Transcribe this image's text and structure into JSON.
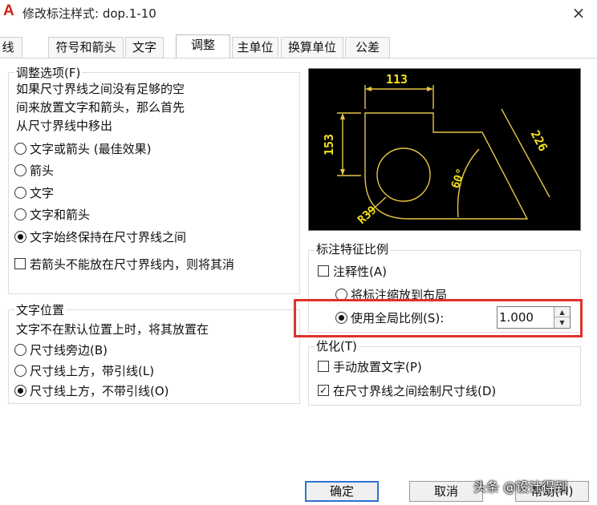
{
  "window": {
    "title": "修改标注样式: dop.1-10",
    "app_icon": "A",
    "close_symbol": "×"
  },
  "tabs": [
    {
      "label": "线"
    },
    {
      "label": "符号和箭头"
    },
    {
      "label": "文字"
    },
    {
      "label": "调整"
    },
    {
      "label": "主单位"
    },
    {
      "label": "换算单位"
    },
    {
      "label": "公差"
    }
  ],
  "fit_options": {
    "title": "调整选项(F)",
    "description": [
      "如果尺寸界线之间没有足够的空",
      "间来放置文字和箭头，那么首先",
      "从尺寸界线中移出"
    ],
    "radios": [
      {
        "label": "文字或箭头 (最佳效果)",
        "selected": false
      },
      {
        "label": "箭头",
        "selected": false
      },
      {
        "label": "文字",
        "selected": false
      },
      {
        "label": "文字和箭头",
        "selected": false
      },
      {
        "label": "文字始终保持在尺寸界线之间",
        "selected": true
      }
    ],
    "checkbox": {
      "label": "若箭头不能放在尺寸界线内，则将其消",
      "checked": false
    }
  },
  "text_placement": {
    "title": "文字位置",
    "description": "文字不在默认位置上时，将其放置在",
    "radios": [
      {
        "label": "尺寸线旁边(B)",
        "selected": false
      },
      {
        "label": "尺寸线上方，带引线(L)",
        "selected": false
      },
      {
        "label": "尺寸线上方，不带引线(O)",
        "selected": true
      }
    ]
  },
  "preview": {
    "labels": [
      "113",
      "153",
      "226",
      "60°",
      "R39"
    ],
    "line_color": "#e8c547",
    "text_color": "#f2e01a"
  },
  "scale": {
    "title": "标注特征比例",
    "annotative": {
      "label": "注释性(A)",
      "checked": false
    },
    "radios": [
      {
        "label": "将标注缩放到布局",
        "selected": false
      },
      {
        "label": "使用全局比例(S):",
        "selected": true
      }
    ],
    "global_scale_value": "1.000"
  },
  "fine_tuning": {
    "title": "优化(T)",
    "checkboxes": [
      {
        "label": "手动放置文字(P)",
        "checked": false
      },
      {
        "label": "在尺寸界线之间绘制尺寸线(D)",
        "checked": true
      }
    ]
  },
  "buttons": {
    "ok": "确定",
    "cancel": "取消",
    "help": "帮助(H)"
  },
  "watermark": "头条 @设计得到",
  "colors": {
    "highlight": "#e0322a",
    "app_icon": "#d32019",
    "primary_border": "#2f73d1"
  }
}
